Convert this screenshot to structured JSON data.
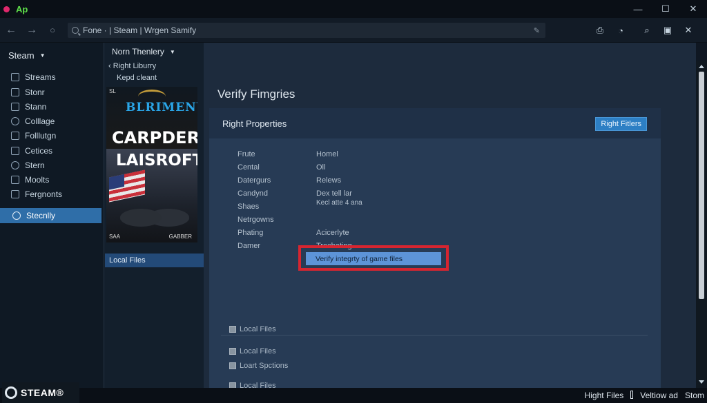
{
  "window": {
    "title": "Ap",
    "controls": {
      "minimize": "—",
      "maximize": "☐",
      "close": "✕"
    }
  },
  "nav": {
    "back": "←",
    "forward": "→",
    "refresh": "○",
    "address": "Fone · | Steam | Wrgen Samify",
    "edit_icon": "✎",
    "right_icons": [
      "⎙",
      "◔",
      "⌕",
      "▣",
      "✕"
    ]
  },
  "sidebar": {
    "header": "Steam",
    "items": [
      {
        "label": "Streams"
      },
      {
        "label": "Stonr"
      },
      {
        "label": "Stann"
      },
      {
        "label": "Colllage"
      },
      {
        "label": "Folllutgn"
      },
      {
        "label": "Cetices"
      },
      {
        "label": "Stern"
      },
      {
        "label": "Moolts"
      },
      {
        "label": "Fergnonts"
      }
    ],
    "active_item": "Stecnlly"
  },
  "column2": {
    "header": "Norn Thenlery",
    "back_label": "Right Liburry",
    "sub_label": "Kepd cleant",
    "art": {
      "tag": "SL",
      "top_title": "BLRIMENY",
      "top_big": "CARPDER",
      "bottom_big": "LAISROFT",
      "bottom_left": "SAA",
      "bottom_right": "GABBER"
    },
    "active_item": "Local Files"
  },
  "main": {
    "title": "Verify Fimgries",
    "panel_title": "Right Properties",
    "panel_button": "Right Fitlers",
    "props_left": [
      "Frute",
      "Cental",
      "Datergurs",
      "Candynd",
      "Shaes",
      "Netrgowns",
      "Phating",
      "Damer"
    ],
    "props_right": [
      "Homel",
      "Oll",
      "Relews",
      "Dex tell lar",
      "Kecl atte 4 ana",
      "",
      "Acicerlyte",
      "Trechating"
    ],
    "verify_button": "Verify integrty of game files",
    "checkboxes": [
      "Local Files",
      "Loart Spctions",
      "Local Files",
      "Local Files"
    ]
  },
  "statusbar": {
    "logo_text": "STEAM®",
    "right_items": [
      "Hight Files",
      "Veltiow ad",
      "Stom"
    ]
  },
  "colors": {
    "accent": "#2f6ea8",
    "highlight_border": "#d62530",
    "verify_button": "#5d94d8",
    "title_green": "#5fe04a"
  }
}
